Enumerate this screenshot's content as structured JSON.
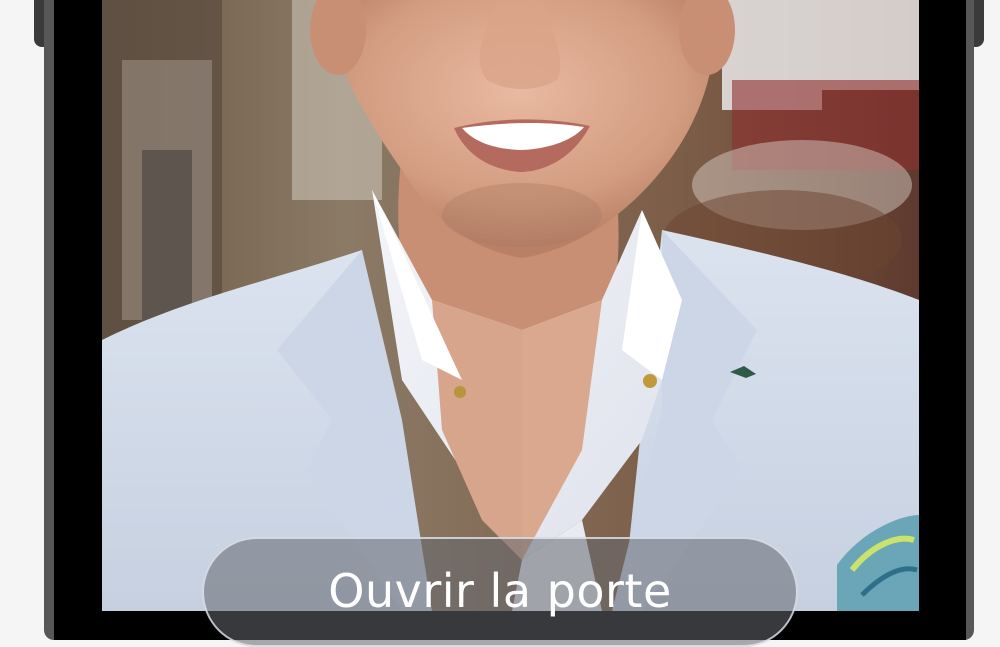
{
  "door_call": {
    "open_button_label": "Ouvrir la porte"
  },
  "colors": {
    "frame": "#575757",
    "bezel": "#000000",
    "top_bar": "#3a3a3a",
    "button_fill": "#646870"
  }
}
